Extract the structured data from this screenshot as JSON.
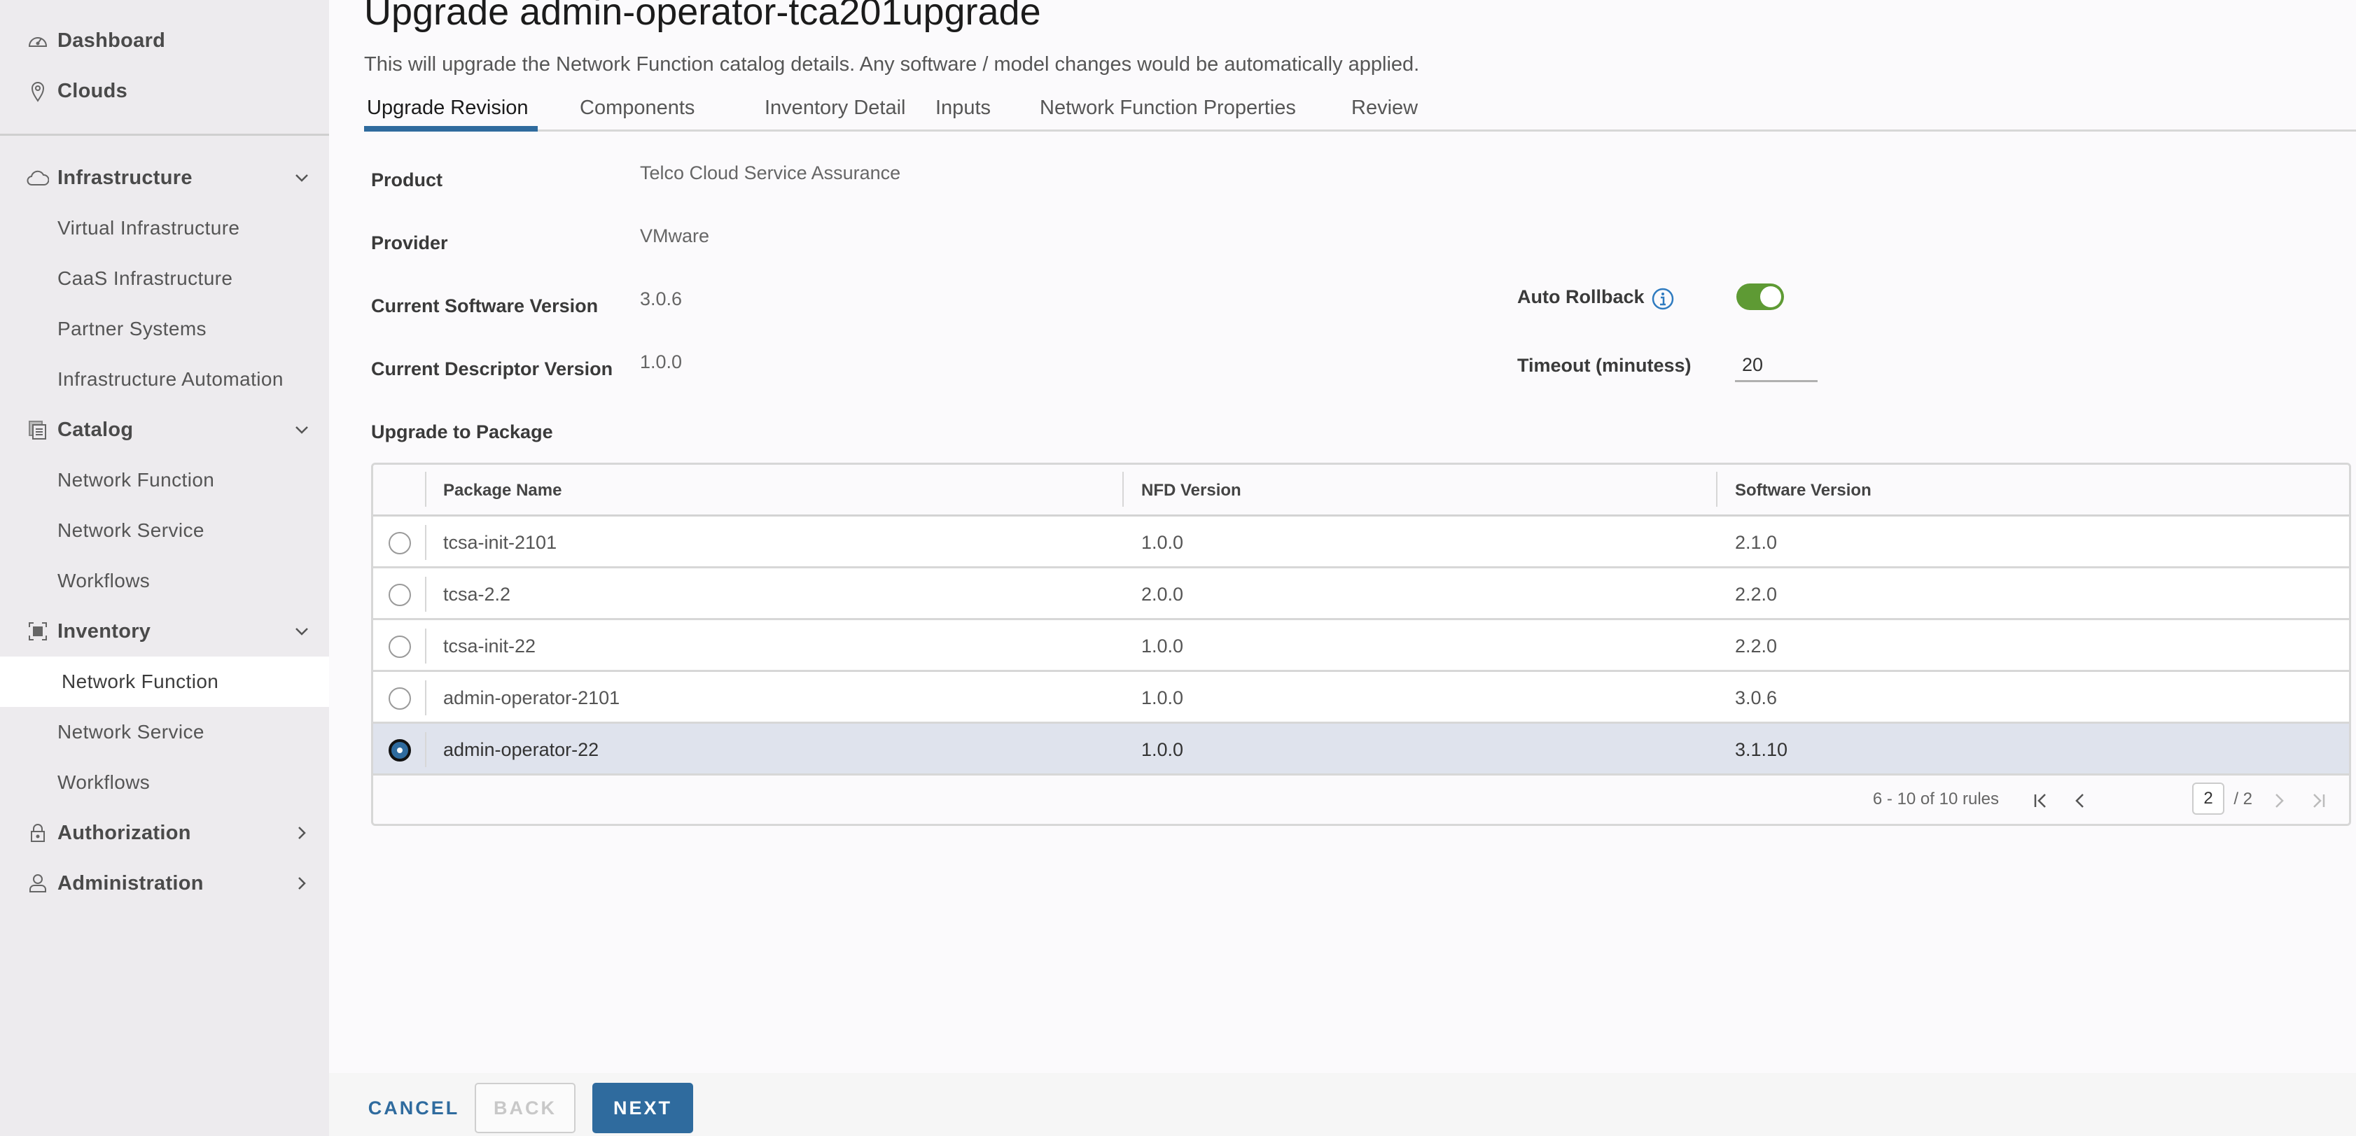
{
  "sidebar": {
    "top_items": [
      {
        "label": "Dashboard",
        "icon": "dashboard-gauge-icon"
      },
      {
        "label": "Clouds",
        "icon": "map-pin-icon"
      }
    ],
    "groups": [
      {
        "label": "Infrastructure",
        "icon": "cloud-icon",
        "expanded": true,
        "items": [
          "Virtual Infrastructure",
          "CaaS Infrastructure",
          "Partner Systems",
          "Infrastructure Automation"
        ]
      },
      {
        "label": "Catalog",
        "icon": "catalog-stack-icon",
        "expanded": true,
        "items": [
          "Network Function",
          "Network Service",
          "Workflows"
        ]
      },
      {
        "label": "Inventory",
        "icon": "inventory-grid-icon",
        "expanded": true,
        "items": [
          "Network Function",
          "Network Service",
          "Workflows"
        ],
        "active_item": "Network Function"
      },
      {
        "label": "Authorization",
        "icon": "lock-icon",
        "expanded": false,
        "items": []
      },
      {
        "label": "Administration",
        "icon": "user-icon",
        "expanded": false,
        "items": []
      }
    ]
  },
  "page": {
    "title": "Upgrade admin-operator-tca201upgrade",
    "subtitle": "This will upgrade the Network Function catalog details. Any software / model changes would be automatically applied."
  },
  "tabs": [
    {
      "label": "Upgrade Revision",
      "active": true
    },
    {
      "label": "Components",
      "active": false
    },
    {
      "label": "Inventory Detail",
      "active": false
    },
    {
      "label": "Inputs",
      "active": false
    },
    {
      "label": "Network Function Properties",
      "active": false
    },
    {
      "label": "Review",
      "active": false
    }
  ],
  "details": {
    "product_label": "Product",
    "product_value": "Telco Cloud Service Assurance",
    "provider_label": "Provider",
    "provider_value": "VMware",
    "sw_version_label": "Current Software Version",
    "sw_version_value": "3.0.6",
    "desc_version_label": "Current Descriptor Version",
    "desc_version_value": "1.0.0",
    "auto_rollback_label": "Auto Rollback",
    "auto_rollback_enabled": true,
    "timeout_label": "Timeout (minutess)",
    "timeout_value": "20",
    "upgrade_to_label": "Upgrade to Package"
  },
  "packages_table": {
    "columns": [
      "Package Name",
      "NFD Version",
      "Software Version"
    ],
    "rows": [
      {
        "name": "tcsa-init-2101",
        "nfd": "1.0.0",
        "software": "2.1.0",
        "selected": false
      },
      {
        "name": "tcsa-2.2",
        "nfd": "2.0.0",
        "software": "2.2.0",
        "selected": false
      },
      {
        "name": "tcsa-init-22",
        "nfd": "1.0.0",
        "software": "2.2.0",
        "selected": false
      },
      {
        "name": "admin-operator-2101",
        "nfd": "1.0.0",
        "software": "3.0.6",
        "selected": false
      },
      {
        "name": "admin-operator-22",
        "nfd": "1.0.0",
        "software": "3.1.10",
        "selected": true
      }
    ],
    "pagination": {
      "summary": "6 - 10 of 10 rules",
      "current_page": "2",
      "total_pages_text": "/ 2"
    }
  },
  "footer": {
    "cancel_label": "CANCEL",
    "back_label": "BACK",
    "next_label": "NEXT"
  },
  "colors": {
    "accent": "#2f6b9e",
    "toggle_on": "#5e9a34",
    "selected_row": "#dfe3ed",
    "sidebar_bg": "#edebee"
  }
}
